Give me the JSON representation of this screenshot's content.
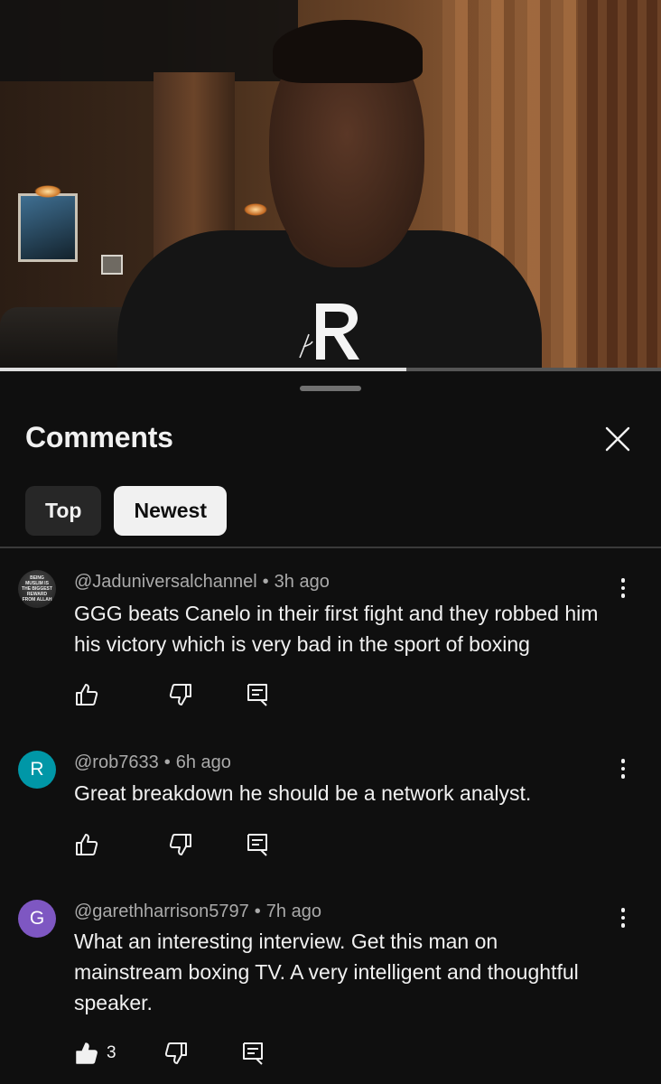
{
  "video": {
    "progress_fraction": 0.615
  },
  "sheet": {
    "title": "Comments",
    "close_icon": "close-icon",
    "filters": [
      {
        "label": "Top",
        "selected": false
      },
      {
        "label": "Newest",
        "selected": true
      }
    ]
  },
  "comments": [
    {
      "author": "@Jaduniversalchannel",
      "time": "3h ago",
      "text": "GGG beats Canelo in their first fight and they robbed him his victory which is very bad in the sport of boxing",
      "avatar_text": "BEING MUSLIM IS THE BIGGEST REWARD FROM ALLAH",
      "likes": "",
      "liked": false
    },
    {
      "author": "@rob7633",
      "time": "6h ago",
      "text": "Great breakdown he should be a network analyst.",
      "avatar_letter": "R",
      "avatar_color": "#0097a7",
      "likes": "",
      "liked": false
    },
    {
      "author": "@garethharrison5797",
      "time": "7h ago",
      "text": "What an interesting interview. Get this man on mainstream boxing TV. A very intelligent and thoughtful speaker.",
      "avatar_letter": "G",
      "avatar_color": "#7e57c2",
      "likes": "3",
      "liked": true
    }
  ],
  "separator": "•"
}
